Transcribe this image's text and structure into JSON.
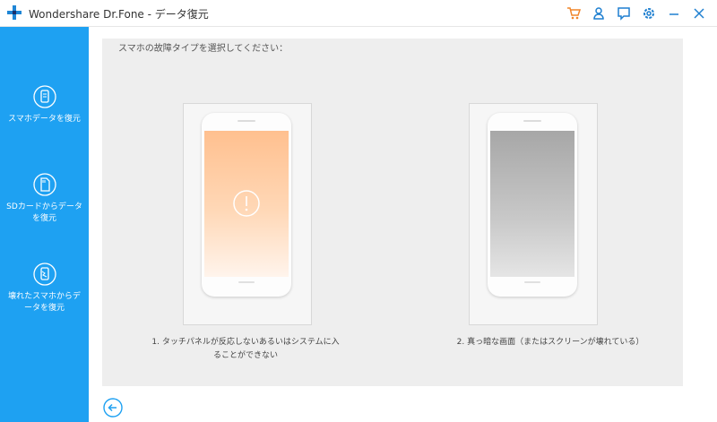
{
  "window": {
    "title": "Wondershare Dr.Fone - データ復元",
    "accent": "#1ea1f2",
    "toolbar_icons": [
      "cart-icon",
      "user-icon",
      "feedback-icon",
      "settings-icon",
      "minimize-icon",
      "close-icon"
    ]
  },
  "sidebar": {
    "items": [
      {
        "icon": "phone-data-icon",
        "label": "スマホデータを復元"
      },
      {
        "icon": "sd-card-icon",
        "label_line1": "SDカードからデータ",
        "label_line2": "を復元"
      },
      {
        "icon": "broken-phone-icon",
        "label_line1": "壊れたスマホからデ",
        "label_line2": "ータを復元"
      }
    ]
  },
  "main": {
    "prompt": "スマホの故障タイプを選択してください：",
    "options": [
      {
        "line1": "1. タッチパネルが反応しないあるいはシステムに入",
        "line2": "ることができない",
        "screen_color": "#ffc08f"
      },
      {
        "line1": "2. 真っ暗な画面（またはスクリーンが壊れている）",
        "screen_color": "#a7a7a7"
      }
    ],
    "back_icon": "back-arrow-icon"
  }
}
